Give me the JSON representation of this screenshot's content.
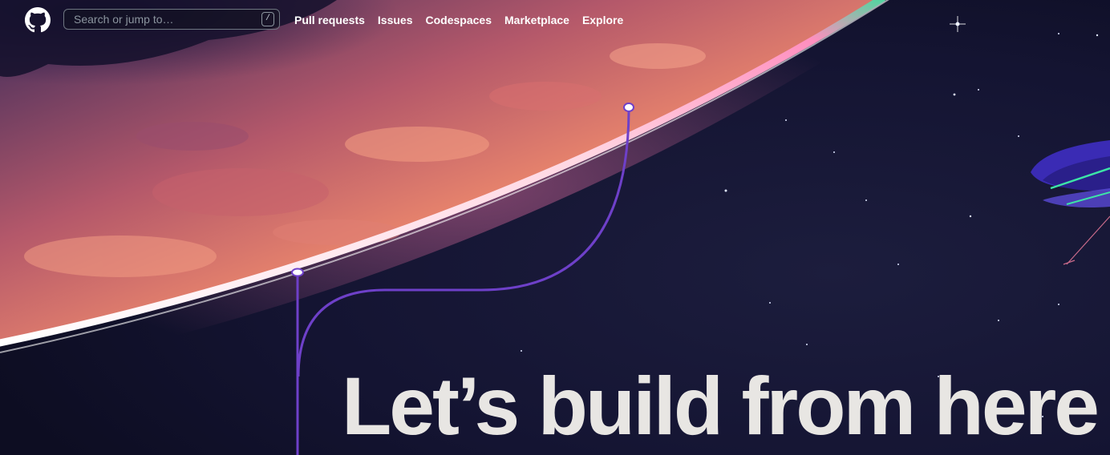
{
  "header": {
    "search": {
      "placeholder": "Search or jump to…",
      "shortcut": "/"
    },
    "nav": [
      {
        "label": "Pull requests"
      },
      {
        "label": "Issues"
      },
      {
        "label": "Codespaces"
      },
      {
        "label": "Marketplace"
      },
      {
        "label": "Explore"
      }
    ]
  },
  "hero": {
    "title": "Let’s build from here"
  },
  "colors": {
    "background": "#10101f",
    "planet": "#e9826e",
    "planet_rim": "#ffffff",
    "line": "#6e40c9",
    "headline": "#e8e6e3"
  },
  "icons": [
    "github-logo-icon",
    "slash-key-icon"
  ]
}
